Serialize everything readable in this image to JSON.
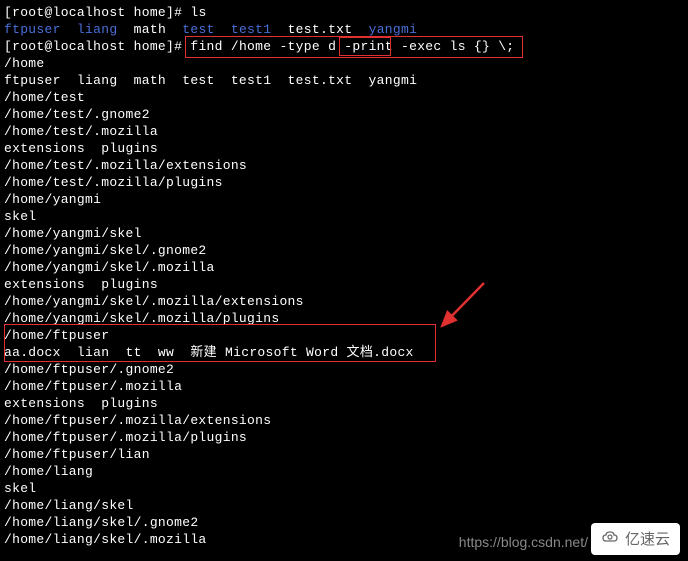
{
  "prompt1": {
    "prefix": "[root@localhost home]# ",
    "cmd": "ls"
  },
  "ls_out": {
    "entries": [
      "ftpuser",
      "liang",
      "math",
      "test",
      "test1",
      "test.txt",
      "yangmi"
    ]
  },
  "prompt2": {
    "prefix": "[root@localhost home]# ",
    "cmd_part1": "find /home -type d ",
    "cmd_print": "-print",
    "cmd_part2": " -exec ls {} \\;"
  },
  "output": [
    "/home",
    "ftpuser  liang  math  test  test1  test.txt  yangmi",
    "/home/test",
    "/home/test/.gnome2",
    "/home/test/.mozilla",
    "extensions  plugins",
    "/home/test/.mozilla/extensions",
    "/home/test/.mozilla/plugins",
    "/home/yangmi",
    "skel",
    "/home/yangmi/skel",
    "/home/yangmi/skel/.gnome2",
    "/home/yangmi/skel/.mozilla",
    "extensions  plugins",
    "/home/yangmi/skel/.mozilla/extensions",
    "/home/yangmi/skel/.mozilla/plugins",
    "/home/ftpuser",
    "aa.docx  lian  tt  ww  新建 Microsoft Word 文档.docx",
    "/home/ftpuser/.gnome2",
    "/home/ftpuser/.mozilla",
    "extensions  plugins",
    "/home/ftpuser/.mozilla/extensions",
    "/home/ftpuser/.mozilla/plugins",
    "/home/ftpuser/lian",
    "/home/liang",
    "skel",
    "/home/liang/skel",
    "/home/liang/skel/.gnome2",
    "/home/liang/skel/.mozilla"
  ],
  "watermark": "https://blog.csdn.net/",
  "logo_text": "亿速云"
}
